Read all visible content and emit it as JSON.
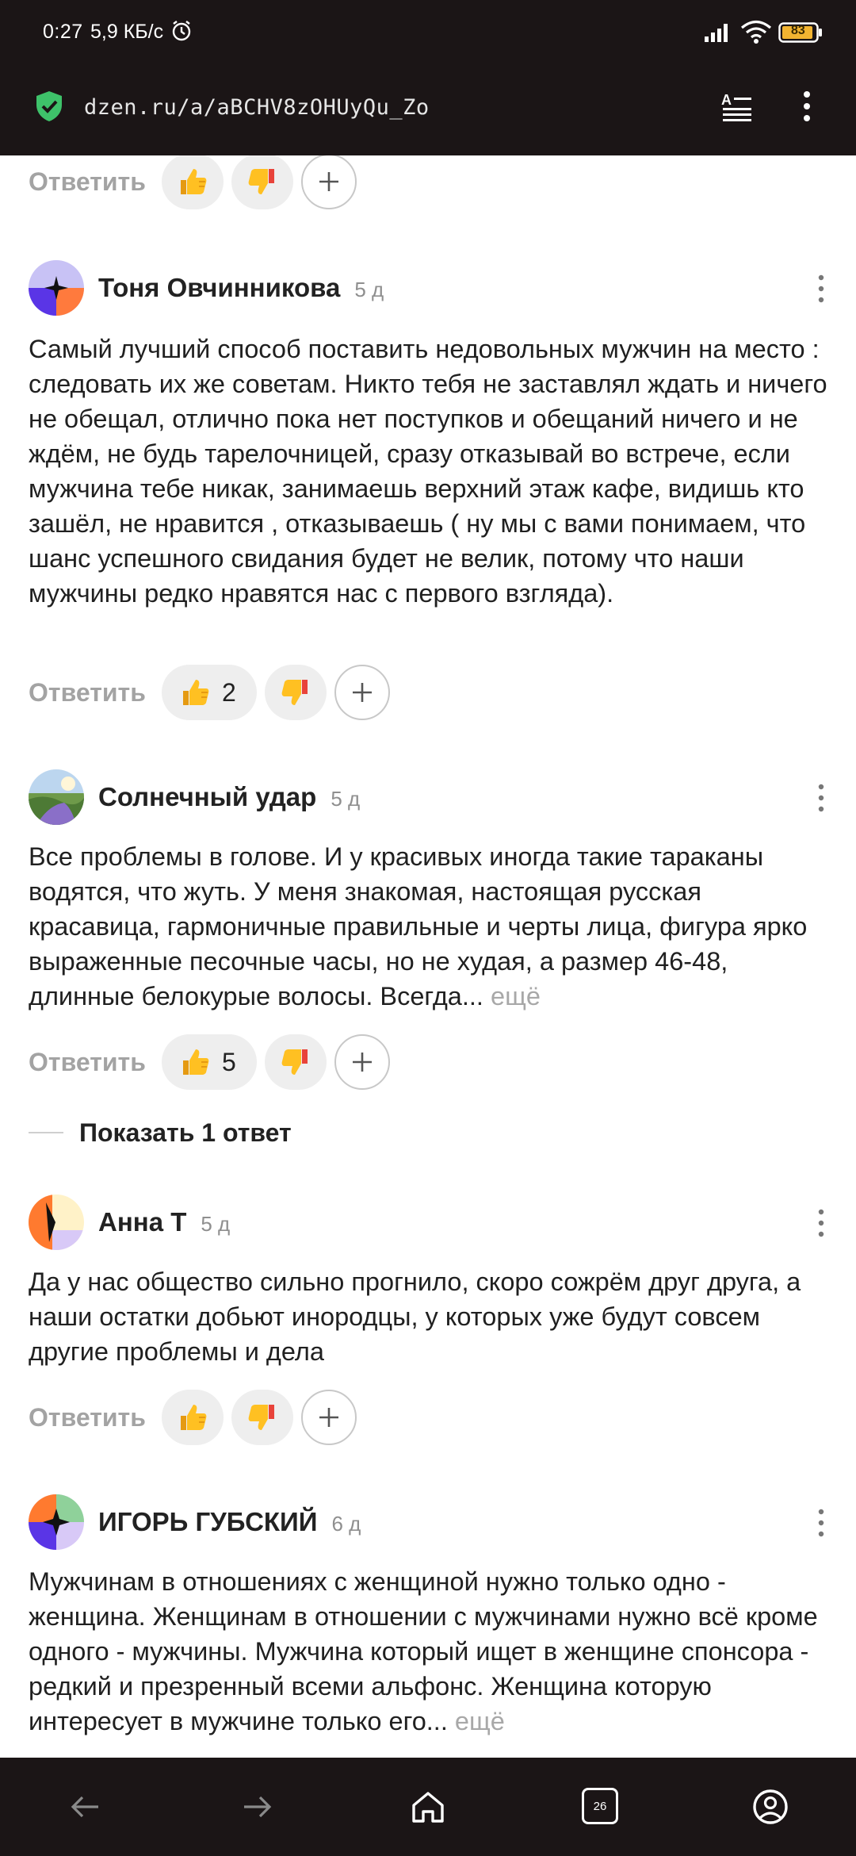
{
  "status_bar": {
    "time": "0:27",
    "speed": "5,9 КБ/с",
    "battery_level": "83"
  },
  "url_bar": {
    "url": "dzen.ru/a/aBCHV8zOHUyQu_Zo"
  },
  "actions": {
    "reply_label": "Ответить"
  },
  "comments": [
    {
      "author": "Тоня Овчинникова",
      "age": "5 д",
      "text": "Самый лучший способ поставить недовольных мужчин на место : следовать их же советам. Никто тебя не заставлял ждать и ничего не обещал, отлично пока нет поступков и обещаний ничего и не ждём, не будь тарелочницей, сразу отказывай во встрече, если мужчина тебе никак, занимаешь верхний этаж кафе, видишь кто зашёл, не нравится , отказываешь ( ну мы с вами понимаем, что шанс успешного свидания будет не велик, потому что наши мужчины редко нравятся нас с первого взгляда).",
      "likes": "2"
    },
    {
      "author": "Солнечный удар",
      "age": "5 д",
      "text": "Все проблемы в голове. И у красивых иногда такие тараканы водятся, что жуть. У меня знакомая, настоящая русская красавица, гармоничные правильные и черты лица, фигура ярко выраженные песочные часы, но не худая, а размер 46-48, длинные белокурые волосы. Всегда...",
      "more": "ещё",
      "likes": "5",
      "show_replies": "Показать 1 ответ"
    },
    {
      "author": "Анна Т",
      "age": "5 д",
      "text": "Да у нас общество сильно прогнило, скоро сожрём друг друга, а наши остатки добьют инородцы, у которых уже будут совсем другие проблемы и дела"
    },
    {
      "author": "ИГОРЬ ГУБСКИЙ",
      "age": "6 д",
      "text": "Мужчинам в отношениях с женщиной нужно только одно - женщина. Женщинам в отношении с мужчинами нужно всё кроме одного - мужчины. Мужчина который ищет в женщине спонсора - редкий и презренный всеми альфонс. Женщина которую интересует в мужчине только его...",
      "more": "ещё"
    }
  ],
  "nav": {
    "tabs_count": "26"
  },
  "colors": {
    "bar_bg": "#1b1516",
    "shield": "#3ec26a",
    "muted": "#a3a3a3",
    "pill_bg": "#eeeeee"
  },
  "icons": [
    "alarm-icon",
    "signal-icon",
    "wifi-icon",
    "battery-icon",
    "shield-check-icon",
    "reader-mode-icon",
    "more-vertical-icon",
    "thumbs-up-icon",
    "thumbs-down-icon",
    "plus-icon",
    "back-arrow-icon",
    "forward-arrow-icon",
    "home-icon",
    "tabs-icon",
    "profile-icon"
  ]
}
